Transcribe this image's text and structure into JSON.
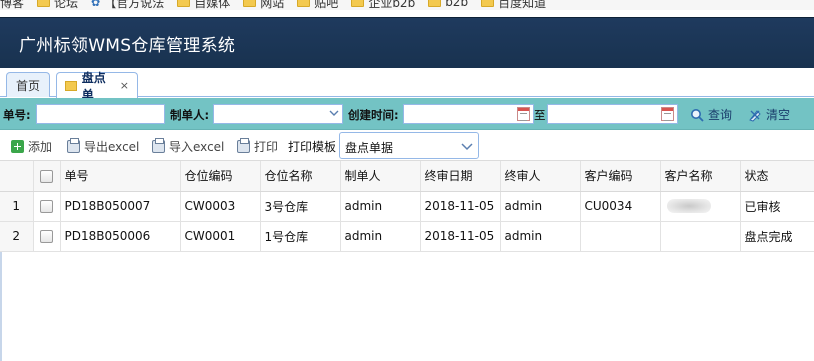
{
  "bookmarks": [
    {
      "label": "博客",
      "icon": "none"
    },
    {
      "label": "论坛",
      "icon": "folder-icon"
    },
    {
      "label": "【官方说法",
      "icon": "gear-icon"
    },
    {
      "label": "自媒体",
      "icon": "folder-icon"
    },
    {
      "label": "网站",
      "icon": "folder-icon"
    },
    {
      "label": "贴吧",
      "icon": "folder-icon"
    },
    {
      "label": "企业b2b",
      "icon": "folder-icon"
    },
    {
      "label": "b2b",
      "icon": "folder-icon"
    },
    {
      "label": "百度知道",
      "icon": "folder-icon"
    }
  ],
  "app": {
    "title": "广州标领WMS仓库管理系统"
  },
  "tabs": {
    "home": "首页",
    "active": "盘点单",
    "close": "×"
  },
  "search": {
    "order_no_label": "单号:",
    "creator_label": "制单人:",
    "created_time_label": "创建时间:",
    "to_label": "至",
    "query_btn": "查询",
    "clear_btn": "清空",
    "order_no_value": "",
    "creator_value": "",
    "date_from": "",
    "date_to": ""
  },
  "toolbar": {
    "add": "添加",
    "export": "导出excel",
    "import": "导入excel",
    "print": "打印",
    "template_label": "打印模板",
    "template_value": "盘点单据"
  },
  "grid": {
    "columns": [
      "单号",
      "仓位编码",
      "仓位名称",
      "制单人",
      "终审日期",
      "终审人",
      "客户编码",
      "客户名称",
      "状态"
    ],
    "rows": [
      {
        "num": "1",
        "order": "PD18B050007",
        "loc_code": "CW0003",
        "loc_name": "3号仓库",
        "creator": "admin",
        "date": "2018-11-05",
        "approver": "admin",
        "cust_code": "CU0034",
        "cust_name": "",
        "status": "已审核"
      },
      {
        "num": "2",
        "order": "PD18B050006",
        "loc_code": "CW0001",
        "loc_name": "1号仓库",
        "creator": "admin",
        "date": "2018-11-05",
        "approver": "admin",
        "cust_code": "",
        "cust_name": "",
        "status": "盘点完成"
      }
    ]
  },
  "colors": {
    "header_bg": "#1f3a5e",
    "search_bg": "#73c3c4",
    "border": "#95b8e7"
  }
}
